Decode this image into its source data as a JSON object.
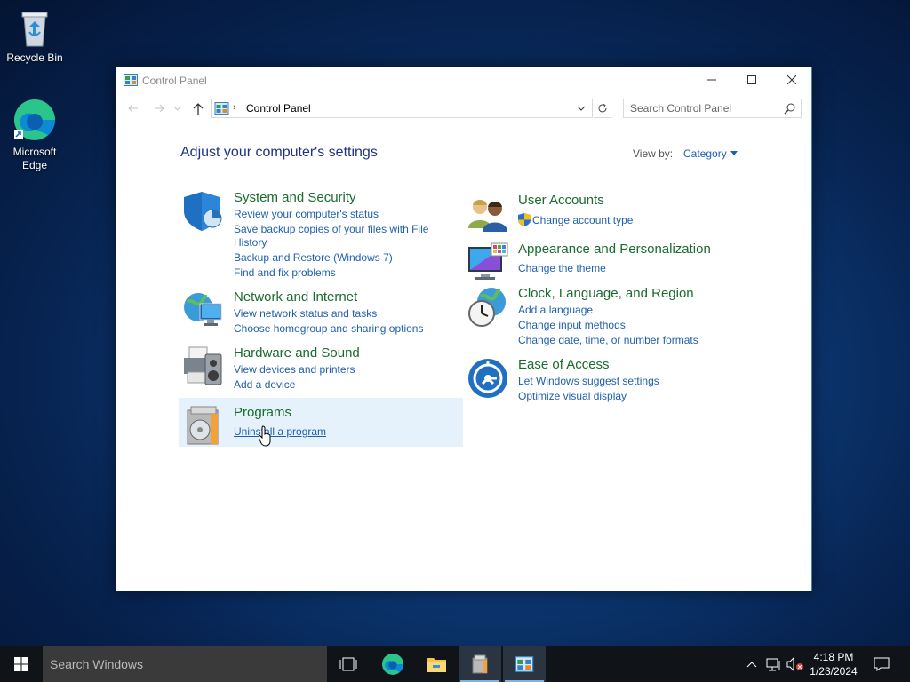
{
  "desktop": {
    "icons": [
      {
        "label": "Recycle Bin"
      },
      {
        "label": "Microsoft Edge"
      }
    ]
  },
  "window": {
    "title": "Control Panel",
    "address": "Control Panel",
    "search_placeholder": "Search Control Panel",
    "heading": "Adjust your computer's settings",
    "view_by_label": "View by:",
    "view_by_value": "Category",
    "categories": [
      {
        "title": "System and Security",
        "links": [
          "Review your computer's status",
          "Save backup copies of your files with File",
          "History",
          "Backup and Restore (Windows 7)",
          "Find and fix problems"
        ]
      },
      {
        "title": "Network and Internet",
        "links": [
          "View network status and tasks",
          "Choose homegroup and sharing options"
        ]
      },
      {
        "title": "Hardware and Sound",
        "links": [
          "View devices and printers",
          "Add a device"
        ]
      },
      {
        "title": "Programs",
        "links": [
          "Uninstall a program"
        ]
      },
      {
        "title": "User Accounts",
        "links": [
          "Change account type"
        ]
      },
      {
        "title": "Appearance and Personalization",
        "links": [
          "Change the theme"
        ]
      },
      {
        "title": "Clock, Language, and Region",
        "links": [
          "Add a language",
          "Change input methods",
          "Change date, time, or number formats"
        ]
      },
      {
        "title": "Ease of Access",
        "links": [
          "Let Windows suggest settings",
          "Optimize visual display"
        ]
      }
    ]
  },
  "taskbar": {
    "search_placeholder": "Search Windows",
    "time": "4:18 PM",
    "date": "1/23/2024"
  },
  "colors": {
    "category_title": "#1a6b2e",
    "link": "#1f5fb0",
    "heading": "#1e3287",
    "highlight": "#e5f1fb"
  }
}
